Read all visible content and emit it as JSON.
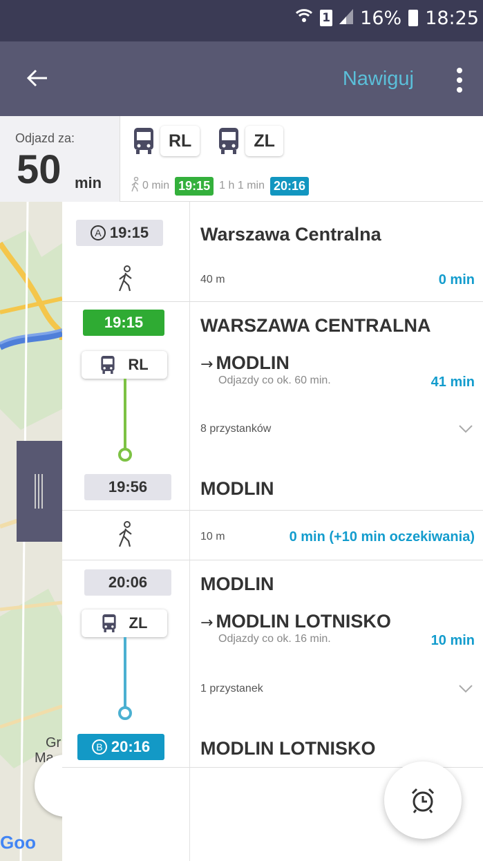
{
  "status_bar": {
    "battery": "16%",
    "time": "18:25",
    "sim": "1"
  },
  "app_bar": {
    "navigate_label": "Nawiguj"
  },
  "summary": {
    "departs_label": "Odjazd za:",
    "departs_value": "50",
    "departs_unit": "min",
    "lines": [
      "RL",
      "ZL"
    ],
    "walk_time": "0 min",
    "start_time": "19:15",
    "duration": "1 h 1 min",
    "end_time": "20:16"
  },
  "map": {
    "label_gr": "Gr",
    "label_ma": "Ma",
    "google": "Goo"
  },
  "colors": {
    "rl_line": "#7dc244",
    "zl_line": "#4bb0d1",
    "accent": "#139ccd",
    "appbar": "#585872"
  },
  "route": {
    "segment_a": {
      "letter": "A",
      "time": "19:15",
      "stop": "Warszawa Centralna",
      "distance": "40 m",
      "duration": "0 min"
    },
    "segment_rl": {
      "time": "19:15",
      "stop": "WARSZAWA CENTRALNA",
      "line": "RL",
      "destination": "MODLIN",
      "frequency": "Odjazdy co ok. 60 min.",
      "duration": "41 min",
      "stops": "8 przystanków",
      "arrival_time": "19:56",
      "arrival_stop": "MODLIN"
    },
    "walk_transfer": {
      "distance": "10 m",
      "duration": "0 min (+10 min oczekiwania)"
    },
    "segment_zl": {
      "time": "20:06",
      "stop": "MODLIN",
      "line": "ZL",
      "destination": "MODLIN LOTNISKO",
      "frequency": "Odjazdy co ok. 16 min.",
      "duration": "10 min",
      "stops": "1 przystanek"
    },
    "segment_b": {
      "letter": "B",
      "time": "20:16",
      "stop": "MODLIN LOTNISKO"
    }
  },
  "icons": [
    "wifi-icon",
    "signal-icon",
    "battery-icon",
    "back-arrow-icon",
    "more-vert-icon",
    "bus-icon",
    "walk-icon",
    "chevron-down-icon",
    "alarm-icon"
  ]
}
